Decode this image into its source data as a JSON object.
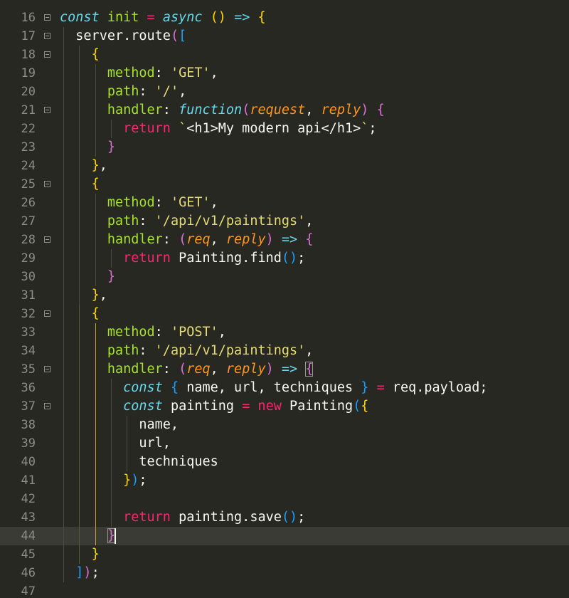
{
  "editor": {
    "theme": {
      "background": "#272822",
      "active_line": "#3a3b34",
      "line_number": "#8d8d86"
    },
    "active_line": 44,
    "lines": [
      {
        "n": "16",
        "fold": true,
        "tokens": [
          [
            "kw-it",
            "const"
          ],
          [
            "pl",
            " "
          ],
          [
            "fn",
            "init"
          ],
          [
            "pl",
            " "
          ],
          [
            "op",
            "="
          ],
          [
            "pl",
            " "
          ],
          [
            "kw-it",
            "async"
          ],
          [
            "pl",
            " "
          ],
          [
            "b1",
            "()"
          ],
          [
            "pl",
            " "
          ],
          [
            "bl",
            "=>"
          ],
          [
            "pl",
            " "
          ],
          [
            "b1",
            "{"
          ]
        ]
      },
      {
        "n": "17",
        "fold": true,
        "tokens": [
          [
            "pl",
            "  server.route"
          ],
          [
            "b2",
            "("
          ],
          [
            "b3",
            "["
          ]
        ]
      },
      {
        "n": "18",
        "fold": true,
        "tokens": [
          [
            "pl",
            "    "
          ],
          [
            "b1",
            "{"
          ]
        ]
      },
      {
        "n": "19",
        "fold": false,
        "tokens": [
          [
            "pl",
            "      "
          ],
          [
            "prop",
            "method"
          ],
          [
            "pl",
            ": "
          ],
          [
            "str",
            "'GET'"
          ],
          [
            "pl",
            ","
          ]
        ]
      },
      {
        "n": "20",
        "fold": false,
        "tokens": [
          [
            "pl",
            "      "
          ],
          [
            "prop",
            "path"
          ],
          [
            "pl",
            ": "
          ],
          [
            "str",
            "'/'"
          ],
          [
            "pl",
            ","
          ]
        ]
      },
      {
        "n": "21",
        "fold": true,
        "tokens": [
          [
            "pl",
            "      "
          ],
          [
            "prop",
            "handler"
          ],
          [
            "pl",
            ": "
          ],
          [
            "kw-it",
            "function"
          ],
          [
            "b2",
            "("
          ],
          [
            "param",
            "request"
          ],
          [
            "pl",
            ", "
          ],
          [
            "param",
            "reply"
          ],
          [
            "b2",
            ")"
          ],
          [
            "pl",
            " "
          ],
          [
            "b2",
            "{"
          ]
        ]
      },
      {
        "n": "22",
        "fold": false,
        "tokens": [
          [
            "pl",
            "        "
          ],
          [
            "kw",
            "return"
          ],
          [
            "pl",
            " "
          ],
          [
            "str",
            "`"
          ],
          [
            "pl",
            "<h1>My modern api</h1>"
          ],
          [
            "str",
            "`"
          ],
          [
            "pl",
            ";"
          ]
        ]
      },
      {
        "n": "23",
        "fold": false,
        "tokens": [
          [
            "pl",
            "      "
          ],
          [
            "b2",
            "}"
          ]
        ]
      },
      {
        "n": "24",
        "fold": false,
        "tokens": [
          [
            "pl",
            "    "
          ],
          [
            "b1",
            "}"
          ],
          [
            "pl",
            ","
          ]
        ]
      },
      {
        "n": "25",
        "fold": true,
        "tokens": [
          [
            "pl",
            "    "
          ],
          [
            "b1",
            "{"
          ]
        ]
      },
      {
        "n": "26",
        "fold": false,
        "tokens": [
          [
            "pl",
            "      "
          ],
          [
            "prop",
            "method"
          ],
          [
            "pl",
            ": "
          ],
          [
            "str",
            "'GET'"
          ],
          [
            "pl",
            ","
          ]
        ]
      },
      {
        "n": "27",
        "fold": false,
        "tokens": [
          [
            "pl",
            "      "
          ],
          [
            "prop",
            "path"
          ],
          [
            "pl",
            ": "
          ],
          [
            "str",
            "'/api/v1/paintings'"
          ],
          [
            "pl",
            ","
          ]
        ]
      },
      {
        "n": "28",
        "fold": true,
        "tokens": [
          [
            "pl",
            "      "
          ],
          [
            "prop",
            "handler"
          ],
          [
            "pl",
            ": "
          ],
          [
            "b2",
            "("
          ],
          [
            "param",
            "req"
          ],
          [
            "pl",
            ", "
          ],
          [
            "param",
            "reply"
          ],
          [
            "b2",
            ")"
          ],
          [
            "pl",
            " "
          ],
          [
            "bl",
            "=>"
          ],
          [
            "pl",
            " "
          ],
          [
            "b2",
            "{"
          ]
        ]
      },
      {
        "n": "29",
        "fold": false,
        "tokens": [
          [
            "pl",
            "        "
          ],
          [
            "kw",
            "return"
          ],
          [
            "pl",
            " Painting.find"
          ],
          [
            "b3",
            "()"
          ],
          [
            "pl",
            ";"
          ]
        ]
      },
      {
        "n": "30",
        "fold": false,
        "tokens": [
          [
            "pl",
            "      "
          ],
          [
            "b2",
            "}"
          ]
        ]
      },
      {
        "n": "31",
        "fold": false,
        "tokens": [
          [
            "pl",
            "    "
          ],
          [
            "b1",
            "}"
          ],
          [
            "pl",
            ","
          ]
        ]
      },
      {
        "n": "32",
        "fold": true,
        "tokens": [
          [
            "pl",
            "    "
          ],
          [
            "b1",
            "{"
          ]
        ]
      },
      {
        "n": "33",
        "fold": false,
        "tokens": [
          [
            "pl",
            "      "
          ],
          [
            "prop",
            "method"
          ],
          [
            "pl",
            ": "
          ],
          [
            "str",
            "'POST'"
          ],
          [
            "pl",
            ","
          ]
        ]
      },
      {
        "n": "34",
        "fold": false,
        "tokens": [
          [
            "pl",
            "      "
          ],
          [
            "prop",
            "path"
          ],
          [
            "pl",
            ": "
          ],
          [
            "str",
            "'/api/v1/paintings'"
          ],
          [
            "pl",
            ","
          ]
        ]
      },
      {
        "n": "35",
        "fold": true,
        "tokens": [
          [
            "pl",
            "      "
          ],
          [
            "prop",
            "handler"
          ],
          [
            "pl",
            ": "
          ],
          [
            "b2",
            "("
          ],
          [
            "param",
            "req"
          ],
          [
            "pl",
            ", "
          ],
          [
            "param",
            "reply"
          ],
          [
            "b2",
            ")"
          ],
          [
            "pl",
            " "
          ],
          [
            "bl",
            "=>"
          ],
          [
            "pl",
            " "
          ],
          [
            "b2box",
            "{"
          ]
        ]
      },
      {
        "n": "36",
        "fold": false,
        "tokens": [
          [
            "pl",
            "        "
          ],
          [
            "kw-it",
            "const"
          ],
          [
            "pl",
            " "
          ],
          [
            "b3",
            "{"
          ],
          [
            "pl",
            " name, url, techniques "
          ],
          [
            "b3",
            "}"
          ],
          [
            "pl",
            " "
          ],
          [
            "op",
            "="
          ],
          [
            "pl",
            " req.payload;"
          ]
        ]
      },
      {
        "n": "37",
        "fold": true,
        "tokens": [
          [
            "pl",
            "        "
          ],
          [
            "kw-it",
            "const"
          ],
          [
            "pl",
            " painting "
          ],
          [
            "op",
            "="
          ],
          [
            "pl",
            " "
          ],
          [
            "kw",
            "new"
          ],
          [
            "pl",
            " Painting"
          ],
          [
            "b3",
            "("
          ],
          [
            "b1",
            "{"
          ]
        ]
      },
      {
        "n": "38",
        "fold": false,
        "tokens": [
          [
            "pl",
            "          name,"
          ]
        ]
      },
      {
        "n": "39",
        "fold": false,
        "tokens": [
          [
            "pl",
            "          url,"
          ]
        ]
      },
      {
        "n": "40",
        "fold": false,
        "tokens": [
          [
            "pl",
            "          techniques"
          ]
        ]
      },
      {
        "n": "41",
        "fold": false,
        "tokens": [
          [
            "pl",
            "        "
          ],
          [
            "b1",
            "}"
          ],
          [
            "b3",
            ")"
          ],
          [
            "pl",
            ";"
          ]
        ]
      },
      {
        "n": "42",
        "fold": false,
        "tokens": []
      },
      {
        "n": "43",
        "fold": false,
        "tokens": [
          [
            "pl",
            "        "
          ],
          [
            "kw",
            "return"
          ],
          [
            "pl",
            " painting.save"
          ],
          [
            "b3",
            "()"
          ],
          [
            "pl",
            ";"
          ]
        ]
      },
      {
        "n": "44",
        "fold": false,
        "tokens": [
          [
            "pl",
            "      "
          ],
          [
            "b2box",
            "}"
          ]
        ]
      },
      {
        "n": "45",
        "fold": false,
        "tokens": [
          [
            "pl",
            "    "
          ],
          [
            "b1",
            "}"
          ]
        ]
      },
      {
        "n": "46",
        "fold": false,
        "tokens": [
          [
            "pl",
            "  "
          ],
          [
            "b3",
            "]"
          ],
          [
            "b2",
            ")"
          ],
          [
            "pl",
            ";"
          ]
        ]
      },
      {
        "n": "47",
        "fold": false,
        "tokens": []
      }
    ]
  }
}
